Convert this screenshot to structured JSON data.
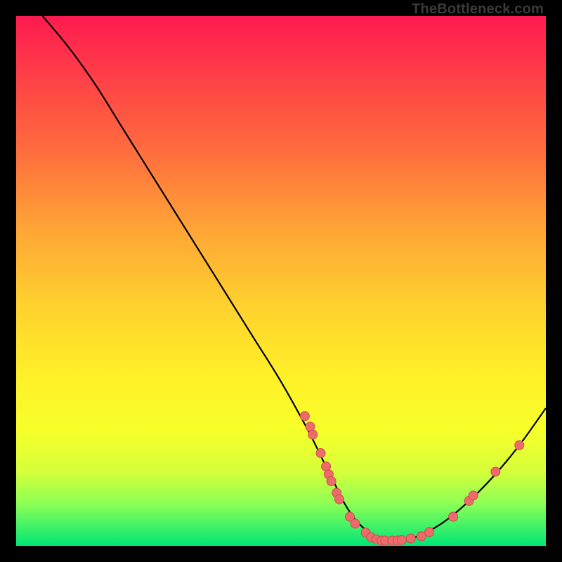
{
  "watermark": "TheBottleneck.com",
  "chart_data": {
    "type": "line",
    "title": "",
    "xlabel": "",
    "ylabel": "",
    "xlim": [
      0,
      100
    ],
    "ylim": [
      0,
      100
    ],
    "series": [
      {
        "name": "curve",
        "x": [
          5,
          10,
          15,
          20,
          25,
          30,
          35,
          40,
          45,
          50,
          55,
          58,
          60,
          62,
          64,
          66,
          68,
          70,
          72,
          75,
          80,
          85,
          90,
          95,
          100
        ],
        "y": [
          100,
          94,
          87,
          79,
          71,
          63,
          55,
          47,
          39,
          31,
          22,
          16,
          12,
          8,
          5,
          3,
          1.5,
          1,
          1,
          1.5,
          4,
          8,
          13,
          19,
          26
        ]
      }
    ],
    "scatter": [
      {
        "x": 54.5,
        "y": 24.5
      },
      {
        "x": 55.5,
        "y": 22.5
      },
      {
        "x": 56.0,
        "y": 21.0
      },
      {
        "x": 57.5,
        "y": 17.5
      },
      {
        "x": 58.5,
        "y": 15.0
      },
      {
        "x": 59.0,
        "y": 13.5
      },
      {
        "x": 59.5,
        "y": 12.2
      },
      {
        "x": 60.5,
        "y": 10.0
      },
      {
        "x": 61.0,
        "y": 8.8
      },
      {
        "x": 63.0,
        "y": 5.5
      },
      {
        "x": 64.0,
        "y": 4.2
      },
      {
        "x": 66.0,
        "y": 2.5
      },
      {
        "x": 67.0,
        "y": 1.6
      },
      {
        "x": 68.0,
        "y": 1.2
      },
      {
        "x": 69.0,
        "y": 1.0
      },
      {
        "x": 69.7,
        "y": 1.0
      },
      {
        "x": 71.0,
        "y": 1.0
      },
      {
        "x": 72.0,
        "y": 1.0
      },
      {
        "x": 72.8,
        "y": 1.1
      },
      {
        "x": 74.5,
        "y": 1.4
      },
      {
        "x": 76.5,
        "y": 1.8
      },
      {
        "x": 78.0,
        "y": 2.6
      },
      {
        "x": 82.5,
        "y": 5.5
      },
      {
        "x": 85.5,
        "y": 8.5
      },
      {
        "x": 86.3,
        "y": 9.5
      },
      {
        "x": 90.5,
        "y": 14.0
      },
      {
        "x": 95.0,
        "y": 19.0
      }
    ],
    "colors": {
      "curve": "#000000",
      "points_fill": "#ed6b6b",
      "points_stroke": "#c94f4f"
    }
  }
}
